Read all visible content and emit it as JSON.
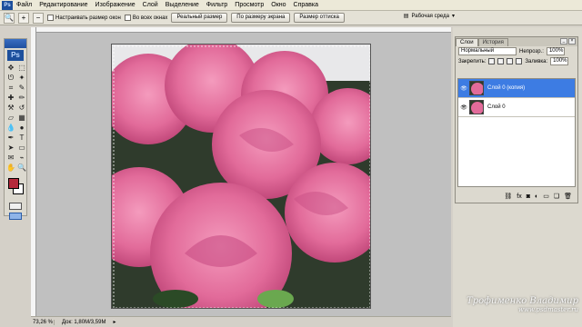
{
  "menu": {
    "items": [
      "Файл",
      "Редактирование",
      "Изображение",
      "Слой",
      "Выделение",
      "Фильтр",
      "Просмотр",
      "Окно",
      "Справка"
    ]
  },
  "options": {
    "fit_windows_label": "Настраивать размер окон",
    "all_windows_label": "Во всех окнах",
    "actual_pixels_label": "Реальный размер",
    "fit_screen_label": "По размеру экрана",
    "print_size_label": "Размер оттиска",
    "workspace_label": "Рабочая среда"
  },
  "tools": {
    "logo": "Ps",
    "foreground_color": "#b5283b",
    "background_color": "#ffffff"
  },
  "status": {
    "zoom": "73,26 %",
    "doc_size": "Док: 1,80M/3,59M"
  },
  "layers_panel": {
    "tabs": [
      "Слои",
      "История"
    ],
    "blend_mode": "Нормальный",
    "opacity_label": "Непрозр.:",
    "opacity_value": "100%",
    "lock_label": "Закрепить:",
    "fill_label": "Заливка:",
    "fill_value": "100%",
    "layers": [
      {
        "name": "Слой 0 (копия)",
        "selected": true
      },
      {
        "name": "Слой 0",
        "selected": false
      }
    ],
    "selected_color": "#3d7ce3"
  },
  "watermark": {
    "name": "Трофименко Владимир",
    "site": "www.psdmaster.ru"
  }
}
